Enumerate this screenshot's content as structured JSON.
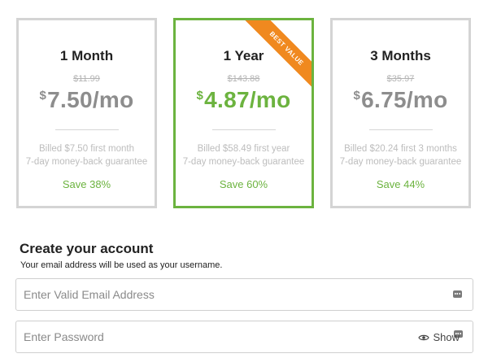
{
  "plans": [
    {
      "name": "1 Month",
      "old_price": "$11.99",
      "currency": "$",
      "price": "7.50/mo",
      "billed": "Billed $7.50 first month",
      "guarantee": "7-day money-back guarantee",
      "save": "Save 38%",
      "selected": false
    },
    {
      "name": "1 Year",
      "old_price": "$143.88",
      "currency": "$",
      "price": "4.87/mo",
      "billed": "Billed $58.49 first year",
      "guarantee": "7-day money-back guarantee",
      "save": "Save 60%",
      "selected": true,
      "ribbon": "BEST VALUE"
    },
    {
      "name": "3 Months",
      "old_price": "$35.97",
      "currency": "$",
      "price": "6.75/mo",
      "billed": "Billed $20.24 first 3 months",
      "guarantee": "7-day money-back guarantee",
      "save": "Save 44%",
      "selected": false
    }
  ],
  "account": {
    "title": "Create your account",
    "note": "Your email address will be used as your username.",
    "email_placeholder": "Enter Valid Email Address",
    "email_value": "",
    "password_placeholder": "Enter Password",
    "password_value": "",
    "show_label": "Show"
  },
  "colors": {
    "accent_green": "#6cb33f",
    "ribbon_orange": "#f0891f",
    "card_border": "#d4d4d4",
    "price_gray": "#8d8d8d"
  },
  "icons": {
    "field_icon": "password-manager-key-icon",
    "show_icon": "eye-icon"
  }
}
